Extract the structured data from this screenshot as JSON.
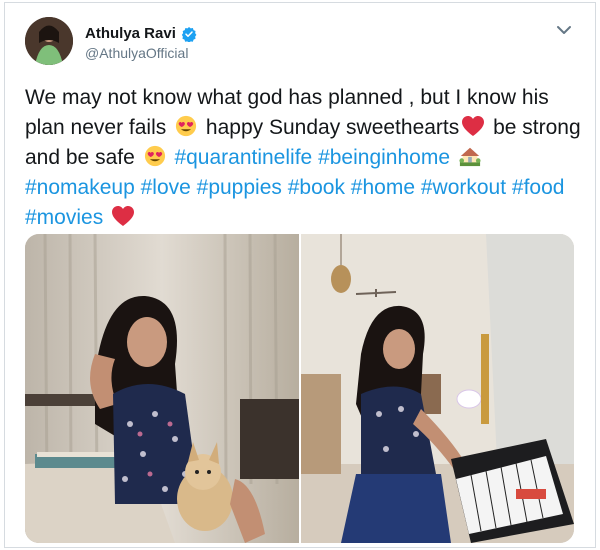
{
  "author": {
    "display_name": "Athulya Ravi",
    "handle": "@AthulyaOfficial",
    "verified": true
  },
  "tweet": {
    "parts": [
      {
        "type": "text",
        "value": "We may not know what god has planned , but I know his plan never fails "
      },
      {
        "type": "emoji",
        "icon": "heart-eyes-emoji"
      },
      {
        "type": "text",
        "value": " happy Sunday sweethearts"
      },
      {
        "type": "emoji",
        "icon": "red-heart-emoji"
      },
      {
        "type": "text",
        "value": " be strong and be safe "
      },
      {
        "type": "emoji",
        "icon": "heart-eyes-emoji"
      },
      {
        "type": "text",
        "value": " "
      },
      {
        "type": "hashtag",
        "value": "#quarantinelife"
      },
      {
        "type": "text",
        "value": " "
      },
      {
        "type": "hashtag",
        "value": "#beinginhome"
      },
      {
        "type": "text",
        "value": " "
      },
      {
        "type": "emoji",
        "icon": "house-with-garden-emoji"
      },
      {
        "type": "text",
        "value": " "
      },
      {
        "type": "hashtag",
        "value": "#nomakeup"
      },
      {
        "type": "text",
        "value": " "
      },
      {
        "type": "hashtag",
        "value": "#love"
      },
      {
        "type": "text",
        "value": " "
      },
      {
        "type": "hashtag",
        "value": "#puppies"
      },
      {
        "type": "text",
        "value": " "
      },
      {
        "type": "hashtag",
        "value": "#book"
      },
      {
        "type": "text",
        "value": " "
      },
      {
        "type": "hashtag",
        "value": "#home"
      },
      {
        "type": "text",
        "value": " "
      },
      {
        "type": "hashtag",
        "value": "#workout"
      },
      {
        "type": "text",
        "value": " "
      },
      {
        "type": "hashtag",
        "value": "#food"
      },
      {
        "type": "text",
        "value": " "
      },
      {
        "type": "hashtag",
        "value": "#movies"
      },
      {
        "type": "text",
        "value": " "
      },
      {
        "type": "emoji",
        "icon": "red-heart-emoji"
      }
    ]
  },
  "media": [
    {
      "icon": "photo-woman-with-puppy"
    },
    {
      "icon": "photo-woman-playing-keyboard"
    }
  ],
  "colors": {
    "hashtag": "#1b95e0",
    "verified": "#1da1f2",
    "secondary_text": "#657786"
  }
}
